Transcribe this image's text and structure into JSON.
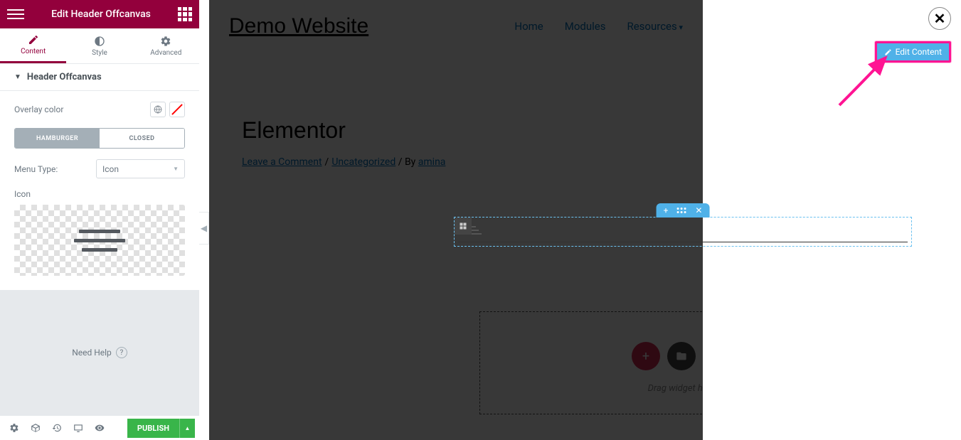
{
  "panel": {
    "title": "Edit Header Offcanvas",
    "tabs": {
      "content": "Content",
      "style": "Style",
      "advanced": "Advanced"
    },
    "section_title": "Header Offcanvas",
    "overlay_label": "Overlay color",
    "toggle": {
      "hamburger": "HAMBURGER",
      "closed": "CLOSED"
    },
    "menu_type_label": "Menu Type:",
    "menu_type_value": "Icon",
    "icon_label": "Icon",
    "help": "Need Help",
    "publish": "PUBLISH"
  },
  "preview": {
    "site_title": "Demo Website",
    "nav": {
      "home": "Home",
      "modules": "Modules",
      "resources": "Resources"
    },
    "post_title": "Elementor",
    "crumb": {
      "leave": "Leave a Comment",
      "sep1": "/",
      "uncat": "Uncategorized",
      "by": " / By ",
      "author": "amina"
    },
    "drop_text": "Drag widget here"
  },
  "offcanvas": {
    "edit_content": "Edit Content"
  }
}
